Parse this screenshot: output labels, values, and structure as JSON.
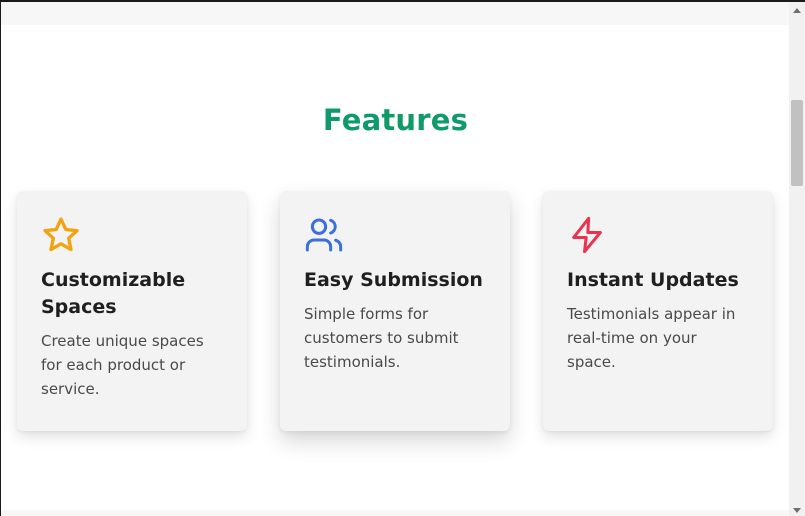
{
  "section": {
    "title": "Features"
  },
  "features": [
    {
      "icon": "star-icon",
      "icon_color": "#f2a311",
      "title": "Customizable Spaces",
      "description": "Create unique spaces for each product or service."
    },
    {
      "icon": "users-icon",
      "icon_color": "#3b6fe0",
      "title": "Easy Submission",
      "description": "Simple forms for customers to submit testimonials."
    },
    {
      "icon": "lightning-icon",
      "icon_color": "#e8344e",
      "title": "Instant Updates",
      "description": "Testimonials appear in real-time on your space."
    }
  ],
  "colors": {
    "accent": "#0f9a6a",
    "card_background": "#f3f3f3",
    "heading_text": "#1f1f1f",
    "body_text": "#4a4a4a"
  }
}
